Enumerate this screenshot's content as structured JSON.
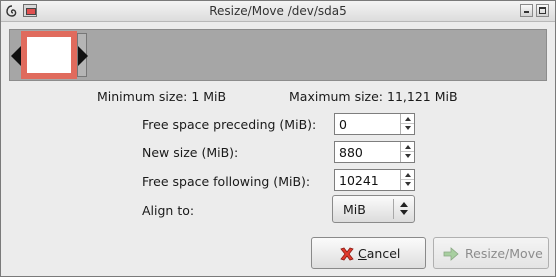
{
  "window": {
    "title": "Resize/Move /dev/sda5"
  },
  "labels": {
    "min_size": "Minimum size: 1 MiB",
    "max_size": "Maximum size: 11,121 MiB",
    "free_preceding": "Free space preceding (MiB):",
    "new_size": "New size (MiB):",
    "free_following": "Free space following (MiB):",
    "align_to": "Align to:"
  },
  "fields": {
    "free_preceding": "0",
    "new_size": "880",
    "free_following": "10241",
    "align_to": "MiB"
  },
  "buttons": {
    "cancel_first": "C",
    "cancel_rest": "ancel",
    "resize": "Resize/Move"
  },
  "colors": {
    "partition_used": "#e06b5d",
    "unallocated": "#a6a6a6"
  },
  "icons": {
    "system_menu": "debian-swirl-icon",
    "app": "gparted-icon",
    "cancel": "red-x-icon",
    "resize": "green-arrow-icon"
  }
}
